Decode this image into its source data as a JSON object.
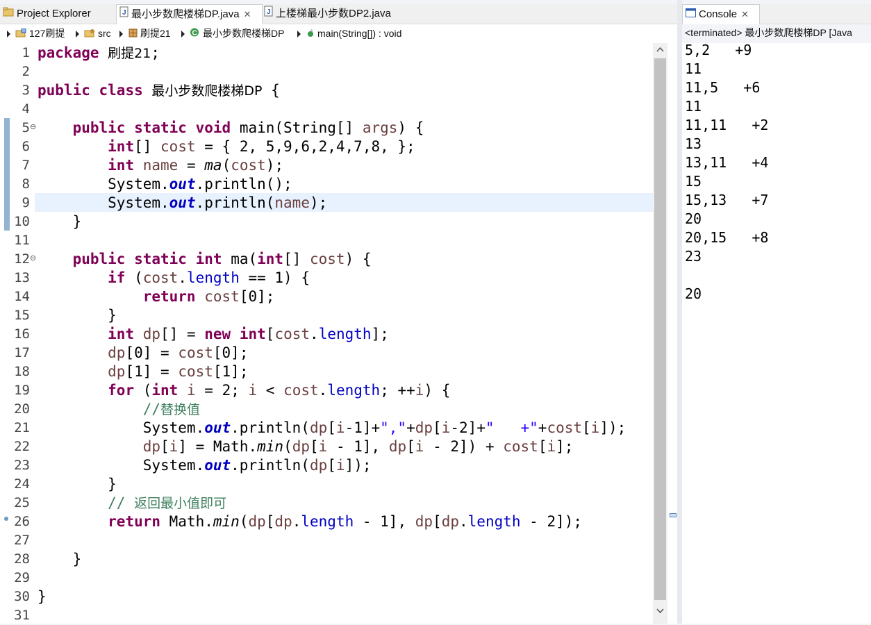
{
  "editor_tabs": {
    "project_explorer": "Project Explorer",
    "active_file": "最小步数爬楼梯DP.java",
    "close_glyph": "✕",
    "other_file": "上楼梯最小步数DP2.java"
  },
  "console_tab": {
    "title": "Console",
    "close_glyph": "✕",
    "status": "<terminated> 最小步数爬楼梯DP [Java"
  },
  "breadcrumb": {
    "project": "127刷提",
    "src": "src",
    "package": "刷提21",
    "class": "最小步数爬楼梯DP",
    "method": "main(String[]) : void"
  },
  "line_numbers": [
    "1",
    "2",
    "3",
    "4",
    "5",
    "6",
    "7",
    "8",
    "9",
    "10",
    "11",
    "12",
    "13",
    "14",
    "15",
    "16",
    "17",
    "18",
    "19",
    "20",
    "21",
    "22",
    "23",
    "24",
    "25",
    "26",
    "27",
    "28",
    "29",
    "30",
    "31"
  ],
  "code": {
    "l1": [
      "package",
      " ",
      "刷提21",
      ";"
    ],
    "l3": [
      "public",
      " ",
      "class",
      " ",
      "最小步数爬楼梯DP",
      " {"
    ],
    "l5": [
      "    ",
      "public",
      " ",
      "static",
      " ",
      "void",
      " main(String[] ",
      "args",
      ") {"
    ],
    "l6": [
      "        ",
      "int",
      "[] ",
      "cost",
      " = { 2, 5,9,6,2,4,7,8, };"
    ],
    "l7": [
      "        ",
      "int",
      " ",
      "name",
      " = ",
      "ma",
      "(",
      "cost",
      ");"
    ],
    "l8": [
      "        System.",
      "out",
      ".println();"
    ],
    "l9": [
      "        System.",
      "out",
      ".println(",
      "name",
      ");"
    ],
    "l10": "    }",
    "l12": [
      "    ",
      "public",
      " ",
      "static",
      " ",
      "int",
      " ma(",
      "int",
      "[] ",
      "cost",
      ") {"
    ],
    "l13": [
      "        ",
      "if",
      " (",
      "cost",
      ".",
      "length",
      " == 1) {"
    ],
    "l14": [
      "            ",
      "return",
      " ",
      "cost",
      "[0];"
    ],
    "l15": "        }",
    "l16": [
      "        ",
      "int",
      " ",
      "dp",
      "[] = ",
      "new",
      " ",
      "int",
      "[",
      "cost",
      ".",
      "length",
      "];"
    ],
    "l17": [
      "        ",
      "dp",
      "[0] = ",
      "cost",
      "[0];"
    ],
    "l18": [
      "        ",
      "dp",
      "[1] = ",
      "cost",
      "[1];"
    ],
    "l19": [
      "        ",
      "for",
      " (",
      "int",
      " ",
      "i",
      " = 2; ",
      "i",
      " < ",
      "cost",
      ".",
      "length",
      "; ++",
      "i",
      ") {"
    ],
    "l20": [
      "            ",
      "//",
      "替换值"
    ],
    "l21": [
      "            System.",
      "out",
      ".println(",
      "dp",
      "[",
      "i",
      "-1]+",
      "\",\"",
      "+",
      "dp",
      "[",
      "i",
      "-2]+",
      "\"   +\"",
      "+",
      "cost",
      "[",
      "i",
      "]);"
    ],
    "l22": [
      "            ",
      "dp",
      "[",
      "i",
      "] = Math.",
      "min",
      "(",
      "dp",
      "[",
      "i",
      " - 1], ",
      "dp",
      "[",
      "i",
      " - 2]) + ",
      "cost",
      "[",
      "i",
      "];"
    ],
    "l23": [
      "            System.",
      "out",
      ".println(",
      "dp",
      "[",
      "i",
      "]);"
    ],
    "l24": "        }",
    "l25": [
      "        ",
      "// ",
      "返回最小值即可"
    ],
    "l26": [
      "        ",
      "return",
      " Math.",
      "min",
      "(",
      "dp",
      "[",
      "dp",
      ".",
      "length",
      " - 1], ",
      "dp",
      "[",
      "dp",
      ".",
      "length",
      " - 2]);"
    ],
    "l28": "    }",
    "l30": "}"
  },
  "console_output": [
    "5,2   +9",
    "11",
    "11,5   +6",
    "11",
    "11,11   +2",
    "13",
    "13,11   +4",
    "15",
    "15,13   +7",
    "20",
    "20,15   +8",
    "23",
    "",
    "20"
  ],
  "colors": {
    "keyword": "#7f0055",
    "local_variable": "#6a3e3e",
    "field": "#0000c0",
    "string": "#2a00ff",
    "comment": "#3f7f5f",
    "current_line": "#e8f2fe"
  }
}
